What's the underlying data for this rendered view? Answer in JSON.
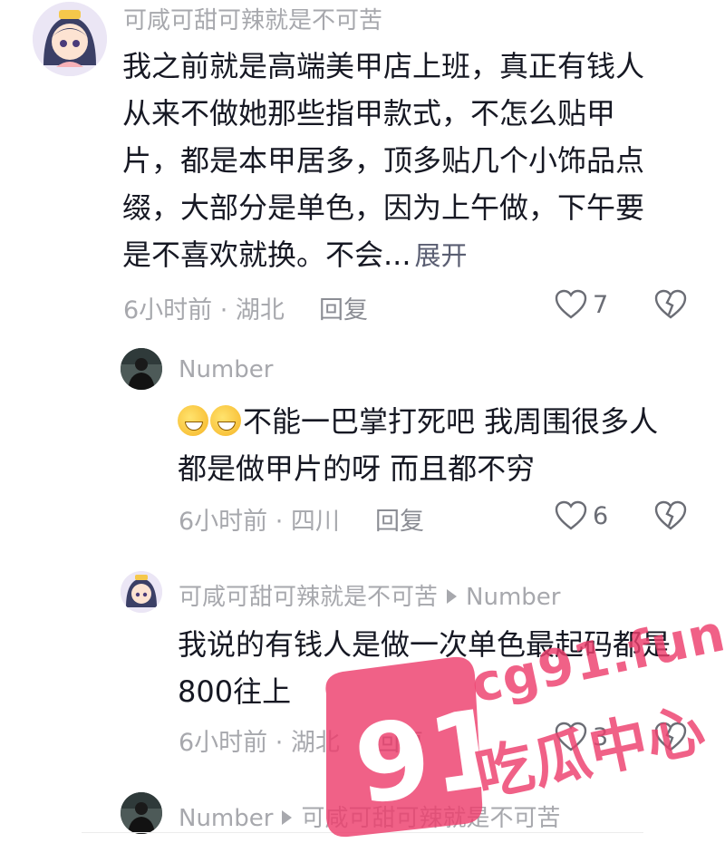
{
  "comment1": {
    "username": "可咸可甜可辣就是不可苦",
    "text_lines": [
      "我之前就是高端美甲店上班，真正有钱人",
      "从来不做她那些指甲款式，不怎么贴甲",
      "片，都是本甲居多，顶多贴几个小饰品点",
      "缀，大部分是单色，因为上午做，下午要"
    ],
    "text_last": "是不喜欢就换。不会...",
    "expand_label": "展开",
    "meta": "6小时前 · 湖北",
    "reply_label": "回复",
    "likes": "7"
  },
  "reply1": {
    "username": "Number",
    "text_line1": "不能一巴掌打死吧 我周围很多人",
    "text_line2": "都是做甲片的呀 而且都不穷",
    "meta": "6小时前 · 四川",
    "reply_label": "回复",
    "likes": "6"
  },
  "reply2": {
    "username": "可咸可甜可辣就是不可苦",
    "reply_to": "Number",
    "text_lines": [
      "我说的有钱人是做一次单色最起码都是",
      "800往上"
    ],
    "meta": "6小时前 · 湖北",
    "reply_label": "回复",
    "likes": "3"
  },
  "reply3": {
    "username": "Number",
    "reply_to": "可咸可甜可辣就是不可苦"
  },
  "watermark": {
    "number": "91",
    "domain": "cg91.fun",
    "slogan": "吃瓜中心"
  },
  "colors": {
    "text": "#161823",
    "muted": "#a7a8ad",
    "watermark": "#ed3e6c"
  }
}
